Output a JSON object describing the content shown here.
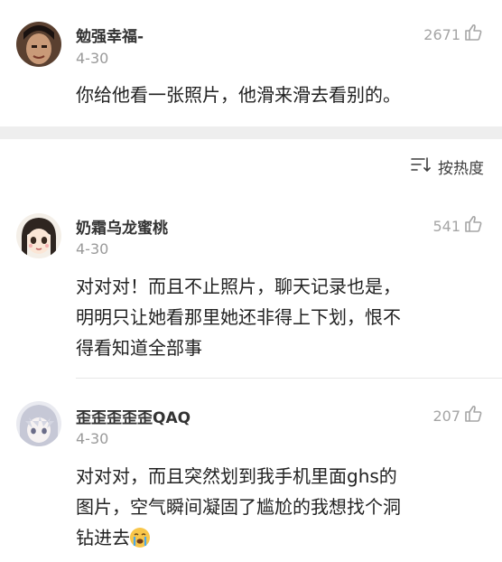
{
  "comments": [
    {
      "username": "勉强幸福-",
      "date": "4-30",
      "likes": "2671",
      "body_lines": [
        "你给他看一张照片，他滑来滑去看别的。"
      ]
    },
    {
      "username": "奶霜乌龙蜜桃",
      "date": "4-30",
      "likes": "541",
      "body_lines": [
        "对对对！而且不止照片，聊天记录也是，",
        "明明只让她看那里她还非得上下划，恨不",
        "得看知道全部事"
      ]
    },
    {
      "username": "歪歪歪歪歪QAQ",
      "date": "4-30",
      "likes": "207",
      "body_lines": [
        "对对对，而且突然划到我手机里面ghs的",
        "图片，空气瞬间凝固了尴尬的我想找个洞",
        "钻进去"
      ]
    }
  ],
  "sort": {
    "label": "按热度"
  },
  "icons": {
    "like": "thumbs-up-icon",
    "sort": "sort-icon",
    "emoji": "crying-face-emoji"
  }
}
